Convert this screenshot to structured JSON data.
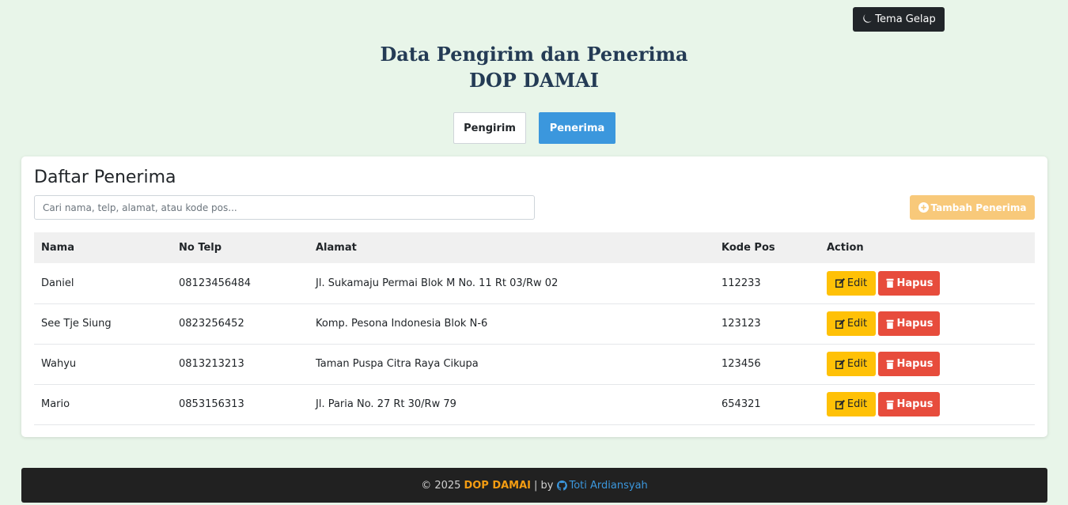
{
  "theme_toggle": {
    "label": "Tema Gelap",
    "icon": "moon-icon"
  },
  "header": {
    "title_line1": "Data Pengirim dan Penerima",
    "title_line2": "DOP DAMAI"
  },
  "tabs": [
    {
      "label": "Pengirim",
      "active": false
    },
    {
      "label": "Penerima",
      "active": true
    }
  ],
  "card": {
    "title": "Daftar Penerima",
    "search_placeholder": "Cari nama, telp, alamat, atau kode pos...",
    "add_button_label": "Tambah Penerima"
  },
  "table": {
    "headers": [
      "Nama",
      "No Telp",
      "Alamat",
      "Kode Pos",
      "Action"
    ],
    "rows": [
      {
        "nama": "Daniel",
        "telp": "08123456484",
        "alamat": "Jl. Sukamaju Permai Blok M No. 11 Rt 03/Rw 02",
        "kode_pos": "112233"
      },
      {
        "nama": "See Tje Siung",
        "telp": "0823256452",
        "alamat": "Komp. Pesona Indonesia Blok N-6",
        "kode_pos": "123123"
      },
      {
        "nama": "Wahyu",
        "telp": "0813213213",
        "alamat": "Taman Puspa Citra Raya Cikupa",
        "kode_pos": "123456"
      },
      {
        "nama": "Mario",
        "telp": "0853156313",
        "alamat": "Jl. Paria No. 27 Rt 30/Rw 79",
        "kode_pos": "654321"
      }
    ],
    "edit_label": "Edit",
    "delete_label": "Hapus"
  },
  "footer": {
    "copyright": "© 2025",
    "brand": "DOP DAMAI",
    "separator": "| by",
    "author": "Toti Ardiansyah"
  },
  "colors": {
    "background": "#e8f5e9",
    "primary": "#3b97dd",
    "warning": "#ffc107",
    "danger": "#e74c3c",
    "title": "#243b55",
    "brand": "#f39c12"
  }
}
